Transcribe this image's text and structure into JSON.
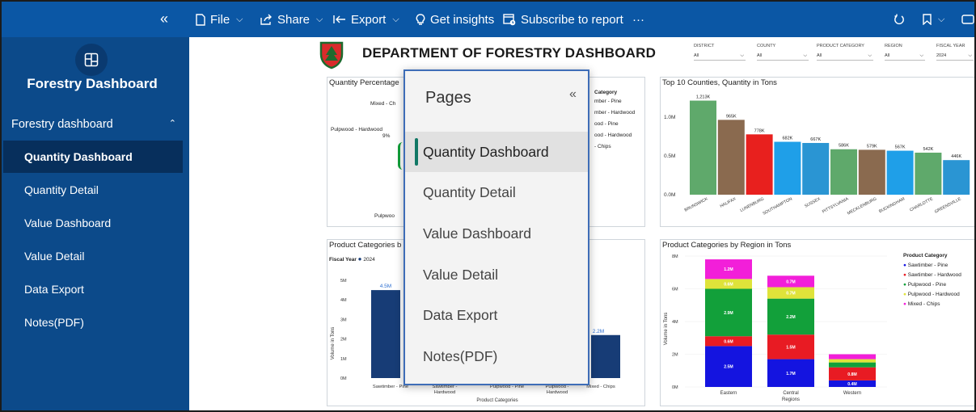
{
  "toolbar": {
    "file": "File",
    "share": "Share",
    "export": "Export",
    "insights": "Get insights",
    "subscribe": "Subscribe to report",
    "more": "···"
  },
  "sidebar": {
    "app_title": "Forestry Dashboard",
    "section": "Forestry dashboard",
    "items": [
      {
        "label": "Quantity Dashboard",
        "active": true
      },
      {
        "label": "Quantity Detail"
      },
      {
        "label": "Value Dashboard"
      },
      {
        "label": "Value Detail"
      },
      {
        "label": "Data Export"
      },
      {
        "label": "Notes(PDF)"
      }
    ]
  },
  "report": {
    "title": "DEPARTMENT OF FORESTRY DASHBOARD",
    "slicers": [
      {
        "label": "DISTRICT",
        "value": "All"
      },
      {
        "label": "COUNTY",
        "value": "All"
      },
      {
        "label": "PRODUCT CATEGORY",
        "value": "All"
      },
      {
        "label": "REGION",
        "value": "All"
      },
      {
        "label": "FISCAL YEAR",
        "value": "2024"
      }
    ]
  },
  "panel_pct": {
    "title": "Quantity Percentage",
    "labels": [
      "Mixed - Ch",
      "Pulpwood - Hardwood",
      "9%",
      "Pulpwoo"
    ],
    "legend_title": "Category",
    "legend": [
      "mber - Pine",
      "mber - Hardwood",
      "ood - Pine",
      "ood - Hardwood",
      "- Chips"
    ]
  },
  "panel_counties": {
    "title": "Top 10 Counties, Quantity in Tons",
    "y_ticks": [
      "1.0M",
      "0.5M",
      "0.0M"
    ],
    "bars": [
      {
        "name": "BRUNSWICK",
        "label": "1,213K",
        "value": 1213,
        "color": "#5fa96b"
      },
      {
        "name": "HALIFAX",
        "label": "965K",
        "value": 965,
        "color": "#8a6a4f"
      },
      {
        "name": "LUNENBURG",
        "label": "778K",
        "value": 778,
        "color": "#e8201e"
      },
      {
        "name": "SOUTHAMPTON",
        "label": "682K",
        "value": 682,
        "color": "#1f9fe8"
      },
      {
        "name": "SUSSEX",
        "label": "667K",
        "value": 667,
        "color": "#2a95d3"
      },
      {
        "name": "PITTSYLVANIA",
        "label": "586K",
        "value": 586,
        "color": "#5fa96b"
      },
      {
        "name": "MECKLENBURG",
        "label": "579K",
        "value": 579,
        "color": "#8a6a4f"
      },
      {
        "name": "BUCKINGHAM",
        "label": "567K",
        "value": 567,
        "color": "#1f9fe8"
      },
      {
        "name": "CHARLOTTE",
        "label": "542K",
        "value": 542,
        "color": "#5fa96b"
      },
      {
        "name": "GREENSVILLE",
        "label": "446K",
        "value": 446,
        "color": "#2a95d3"
      }
    ]
  },
  "panel_cat": {
    "title": "Product Categories b",
    "fy_label": "Fiscal Year",
    "fy_value": "2024",
    "ylabel": "Volume in Tons",
    "xlabel": "Product Categories",
    "y_ticks": [
      "5M",
      "4M",
      "3M",
      "2M",
      "1M",
      "0M"
    ],
    "bars": [
      {
        "name": "Sawtimber - Pine",
        "label": "4.5M",
        "value": 4.5
      },
      {
        "name": "Sawtimber - Hardwood",
        "label": "",
        "value": 0
      },
      {
        "name": "Pulpwood - Pine",
        "label": "",
        "value": 0
      },
      {
        "name": "Pulpwood - Hardwood",
        "label": "",
        "value": 0
      },
      {
        "name": "Mixed - Chips",
        "label": "2.2M",
        "value": 2.2
      }
    ],
    "x_labels": [
      "Sawtimber - Pine",
      "Sawtimber -\nHardwood",
      "Pulpwood - Pine",
      "Pulpwood -\nHardwood",
      "Mixed - Chips"
    ]
  },
  "panel_region": {
    "title": "Product Categories by Region in Tons",
    "ylabel": "Volume in Tons",
    "xlabel": "Regions",
    "y_ticks": [
      "8M",
      "6M",
      "4M",
      "2M",
      "0M"
    ],
    "legend_title": "Product Category",
    "legend": [
      {
        "name": "Sawtimber - Pine",
        "color": "#1414e0"
      },
      {
        "name": "Sawtimber - Hardwood",
        "color": "#e81b23"
      },
      {
        "name": "Pulpwood - Pine",
        "color": "#12a03a"
      },
      {
        "name": "Pulpwood - Hardwood",
        "color": "#dfe33a"
      },
      {
        "name": "Mixed - Chips",
        "color": "#f21fd9"
      }
    ],
    "regions": [
      {
        "name": "Eastern",
        "segments": [
          2.5,
          0.6,
          2.9,
          0.6,
          1.2
        ],
        "labels": [
          "2.5M",
          "0.6M",
          "2.9M",
          "0.6M",
          "1.2M"
        ]
      },
      {
        "name": "Central",
        "segments": [
          1.7,
          1.5,
          2.2,
          0.7,
          0.7
        ],
        "labels": [
          "1.7M",
          "1.5M",
          "2.2M",
          "0.7M",
          "0.7M"
        ]
      },
      {
        "name": "Western",
        "segments": [
          0.4,
          0.8,
          0.3,
          0.2,
          0.3
        ],
        "labels": [
          "0.4M",
          "0.8M",
          "",
          "",
          ""
        ]
      }
    ]
  },
  "pages_flyout": {
    "title": "Pages",
    "items": [
      {
        "label": "Quantity Dashboard",
        "active": true
      },
      {
        "label": "Quantity Detail"
      },
      {
        "label": "Value Dashboard"
      },
      {
        "label": "Value Detail"
      },
      {
        "label": "Data Export"
      },
      {
        "label": "Notes(PDF)"
      }
    ]
  }
}
